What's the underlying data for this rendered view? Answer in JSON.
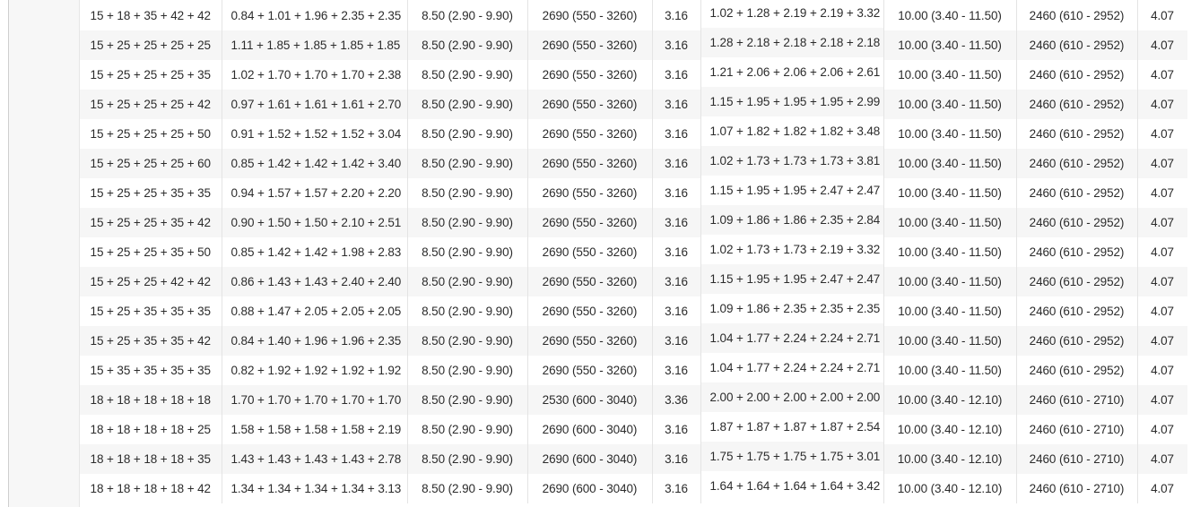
{
  "table": {
    "rows": [
      [
        "15 + 18 + 35 + 42 + 42",
        "0.84 + 1.01 + 1.96 + 2.35 + 2.35",
        "8.50 (2.90 - 9.90)",
        "2690 (550 - 3260)",
        "3.16",
        "1.02 + 1.28 + 2.19 + 2.19 + 3.32",
        "10.00 (3.40 - 11.50)",
        "2460 (610 - 2952)",
        "4.07"
      ],
      [
        "15 + 25 + 25 + 25 + 25",
        "1.11 + 1.85 + 1.85 + 1.85 + 1.85",
        "8.50 (2.90 - 9.90)",
        "2690 (550 - 3260)",
        "3.16",
        "1.28 + 2.18 + 2.18 + 2.18 + 2.18",
        "10.00 (3.40 - 11.50)",
        "2460 (610 - 2952)",
        "4.07"
      ],
      [
        "15 + 25 + 25 + 25 + 35",
        "1.02 + 1.70 + 1.70 + 1.70 + 2.38",
        "8.50 (2.90 - 9.90)",
        "2690 (550 - 3260)",
        "3.16",
        "1.21 + 2.06 + 2.06 + 2.06 + 2.61",
        "10.00 (3.40 - 11.50)",
        "2460 (610 - 2952)",
        "4.07"
      ],
      [
        "15 + 25 + 25 + 25 + 42",
        "0.97 + 1.61 + 1.61 + 1.61 + 2.70",
        "8.50 (2.90 - 9.90)",
        "2690 (550 - 3260)",
        "3.16",
        "1.15 + 1.95 + 1.95 + 1.95 + 2.99",
        "10.00 (3.40 - 11.50)",
        "2460 (610 - 2952)",
        "4.07"
      ],
      [
        "15 + 25 + 25 + 25 + 50",
        "0.91 + 1.52 + 1.52 + 1.52 + 3.04",
        "8.50 (2.90 - 9.90)",
        "2690 (550 - 3260)",
        "3.16",
        "1.07 + 1.82 + 1.82 + 1.82 + 3.48",
        "10.00 (3.40 - 11.50)",
        "2460 (610 - 2952)",
        "4.07"
      ],
      [
        "15 + 25 + 25 + 25 + 60",
        "0.85 + 1.42 + 1.42 + 1.42 + 3.40",
        "8.50 (2.90 - 9.90)",
        "2690 (550 - 3260)",
        "3.16",
        "1.02 + 1.73 + 1.73 + 1.73 + 3.81",
        "10.00 (3.40 - 11.50)",
        "2460 (610 - 2952)",
        "4.07"
      ],
      [
        "15 + 25 + 25 + 35 + 35",
        "0.94 + 1.57 + 1.57 + 2.20 + 2.20",
        "8.50 (2.90 - 9.90)",
        "2690 (550 - 3260)",
        "3.16",
        "1.15 + 1.95 + 1.95 + 2.47 + 2.47",
        "10.00 (3.40 - 11.50)",
        "2460 (610 - 2952)",
        "4.07"
      ],
      [
        "15 + 25 + 25 + 35 + 42",
        "0.90 + 1.50 + 1.50 + 2.10 + 2.51",
        "8.50 (2.90 - 9.90)",
        "2690 (550 - 3260)",
        "3.16",
        "1.09 + 1.86 + 1.86 + 2.35 + 2.84",
        "10.00 (3.40 - 11.50)",
        "2460 (610 - 2952)",
        "4.07"
      ],
      [
        "15 + 25 + 25 + 35 + 50",
        "0.85 + 1.42 + 1.42 + 1.98 + 2.83",
        "8.50 (2.90 - 9.90)",
        "2690 (550 - 3260)",
        "3.16",
        "1.02 + 1.73 + 1.73 + 2.19 + 3.32",
        "10.00 (3.40 - 11.50)",
        "2460 (610 - 2952)",
        "4.07"
      ],
      [
        "15 + 25 + 25 + 42 + 42",
        "0.86 + 1.43 + 1.43 + 2.40 + 2.40",
        "8.50 (2.90 - 9.90)",
        "2690 (550 - 3260)",
        "3.16",
        "1.15 + 1.95 + 1.95 + 2.47 + 2.47",
        "10.00 (3.40 - 11.50)",
        "2460 (610 - 2952)",
        "4.07"
      ],
      [
        "15 + 25 + 35 + 35 + 35",
        "0.88 + 1.47 + 2.05 + 2.05 + 2.05",
        "8.50 (2.90 - 9.90)",
        "2690 (550 - 3260)",
        "3.16",
        "1.09 + 1.86 + 2.35 + 2.35 + 2.35",
        "10.00 (3.40 - 11.50)",
        "2460 (610 - 2952)",
        "4.07"
      ],
      [
        "15 + 25 + 35 + 35 + 42",
        "0.84 + 1.40 + 1.96 + 1.96 + 2.35",
        "8.50 (2.90 - 9.90)",
        "2690 (550 - 3260)",
        "3.16",
        "1.04 + 1.77 + 2.24 + 2.24 + 2.71",
        "10.00 (3.40 - 11.50)",
        "2460 (610 - 2952)",
        "4.07"
      ],
      [
        "15 + 35 + 35 + 35 + 35",
        "0.82 + 1.92 + 1.92 + 1.92 + 1.92",
        "8.50 (2.90 - 9.90)",
        "2690 (550 - 3260)",
        "3.16",
        "1.04 + 1.77 + 2.24 + 2.24 + 2.71",
        "10.00 (3.40 - 11.50)",
        "2460 (610 - 2952)",
        "4.07"
      ],
      [
        "18 + 18 + 18 + 18 + 18",
        "1.70 + 1.70 + 1.70 + 1.70 + 1.70",
        "8.50 (2.90 - 9.90)",
        "2530 (600 - 3040)",
        "3.36",
        "2.00 + 2.00 + 2.00 + 2.00 + 2.00",
        "10.00 (3.40 - 12.10)",
        "2460 (610 - 2710)",
        "4.07"
      ],
      [
        "18 + 18 + 18 + 18 + 25",
        "1.58 + 1.58 + 1.58 + 1.58 + 2.19",
        "8.50 (2.90 - 9.90)",
        "2690 (600 - 3040)",
        "3.16",
        "1.87 + 1.87 + 1.87 + 1.87 + 2.54",
        "10.00 (3.40 - 12.10)",
        "2460 (610 - 2710)",
        "4.07"
      ],
      [
        "18 + 18 + 18 + 18 + 35",
        "1.43 + 1.43 + 1.43 + 1.43 + 2.78",
        "8.50 (2.90 - 9.90)",
        "2690 (600 - 3040)",
        "3.16",
        "1.75 + 1.75 + 1.75 + 1.75 + 3.01",
        "10.00 (3.40 - 12.10)",
        "2460 (610 - 2710)",
        "4.07"
      ],
      [
        "18 + 18 + 18 + 18 + 42",
        "1.34 + 1.34 + 1.34 + 1.34 + 3.13",
        "8.50 (2.90 - 9.90)",
        "2690 (600 - 3040)",
        "3.16",
        "1.64 + 1.64 + 1.64 + 1.64 + 3.42",
        "10.00 (3.40 - 12.10)",
        "2460 (610 - 2710)",
        "4.07"
      ]
    ]
  }
}
